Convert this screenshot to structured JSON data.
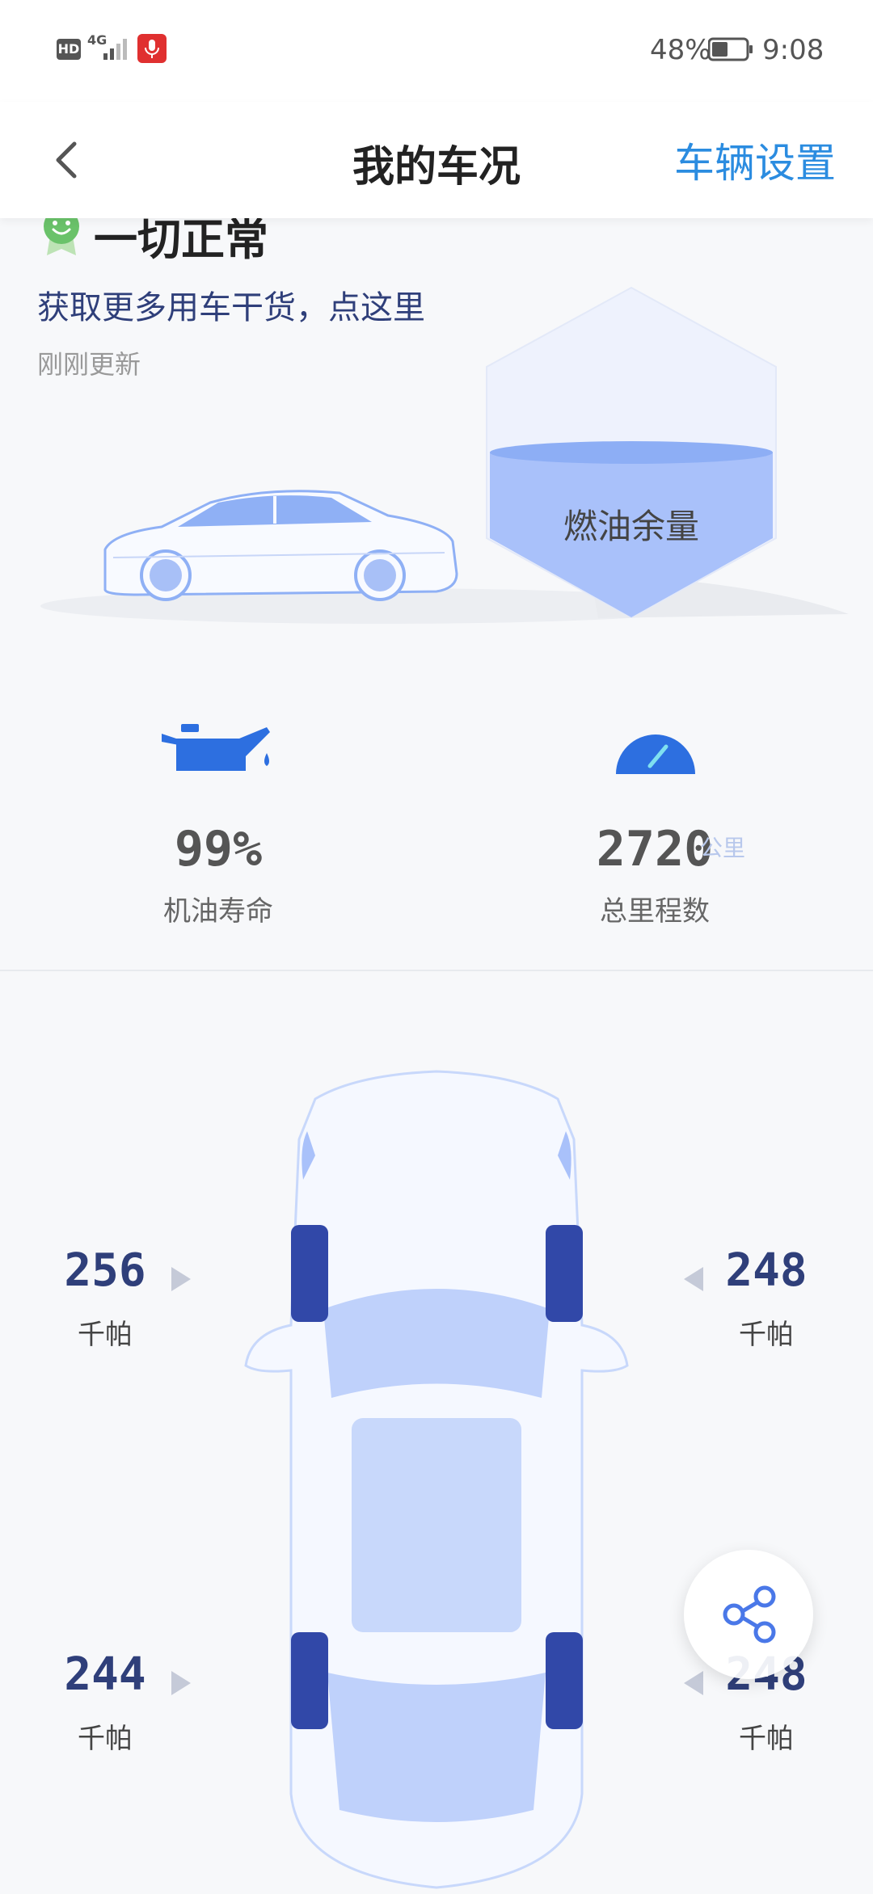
{
  "status_bar": {
    "hd": "HD",
    "network": "4G",
    "battery_percent": "48%",
    "time": "9:08",
    "battery_level": 0.48
  },
  "header": {
    "back_icon": "chevron-left-icon",
    "title": "我的车况",
    "settings_label": "车辆设置"
  },
  "summary": {
    "status": "一切正常",
    "tip_link": "获取更多用车干货，点这里",
    "updated": "刚刚更新"
  },
  "fuel": {
    "label": "燃油余量"
  },
  "metrics": {
    "oil": {
      "icon": "oil-can-icon",
      "value": "99%",
      "label": "机油寿命"
    },
    "mileage": {
      "icon": "speedometer-icon",
      "value": "2720",
      "unit": "公里",
      "label": "总里程数"
    }
  },
  "tires": {
    "front_left": {
      "value": "256",
      "unit": "千帕"
    },
    "front_right": {
      "value": "248",
      "unit": "千帕"
    },
    "rear_left": {
      "value": "244",
      "unit": "千帕"
    },
    "rear_right": {
      "value": "248",
      "unit": "千帕"
    }
  },
  "share": {
    "icon": "share-icon"
  },
  "colors": {
    "accent": "#2b8ce0",
    "tire_value": "#2f3f7a",
    "car_blue": "#8fb0f5"
  }
}
